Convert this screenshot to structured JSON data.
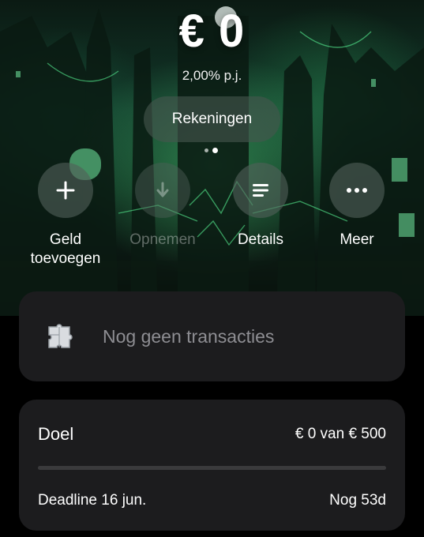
{
  "balance": "€ 0",
  "interest_rate": "2,00% p.j.",
  "accounts_button": "Rekeningen",
  "pager": {
    "count": 2,
    "active_index": 1
  },
  "actions": [
    {
      "label": "Geld toevoegen",
      "icon": "plus-icon",
      "enabled": true
    },
    {
      "label": "Opnemen",
      "icon": "arrow-down-icon",
      "enabled": false
    },
    {
      "label": "Details",
      "icon": "details-list-icon",
      "enabled": true
    },
    {
      "label": "Meer",
      "icon": "more-dots-icon",
      "enabled": true
    }
  ],
  "transactions": {
    "empty_text": "Nog geen transacties",
    "icon": "puzzle-icon"
  },
  "goal": {
    "title": "Doel",
    "amount_text": "€ 0 van € 500",
    "progress_fraction": 0,
    "deadline": "Deadline 16 jun.",
    "remaining": "Nog 53d"
  },
  "colors": {
    "card": "#1c1c1e",
    "muted_text": "#8e8e93",
    "hero_green": "#2e8b57"
  }
}
